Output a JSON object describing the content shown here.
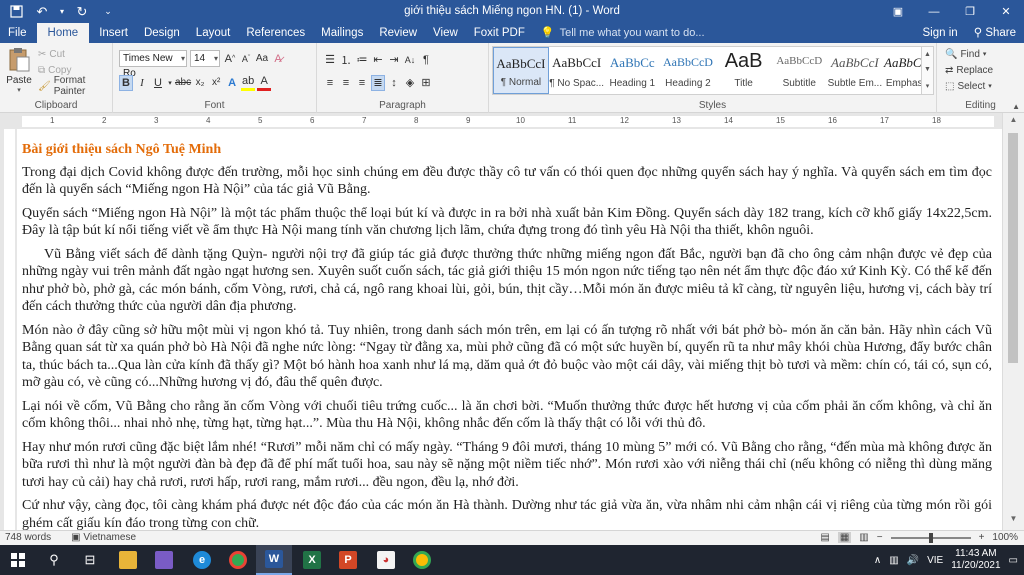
{
  "titlebar": {
    "title": "giới thiệu sách Miếng ngon HN. (1) - Word",
    "controls": [
      "ribbon-display-icon",
      "minimize-icon",
      "restore-icon",
      "close-icon"
    ]
  },
  "tabs": {
    "items": [
      "File",
      "Home",
      "Insert",
      "Design",
      "Layout",
      "References",
      "Mailings",
      "Review",
      "View",
      "Foxit PDF"
    ],
    "active": "Home",
    "tell_me": "Tell me what you want to do...",
    "sign_in": "Sign in",
    "share": "Share"
  },
  "ribbon": {
    "clipboard": {
      "label": "Clipboard",
      "paste": "Paste",
      "cut": "Cut",
      "copy": "Copy",
      "format_painter": "Format Painter"
    },
    "font": {
      "label": "Font",
      "font_name": "Times New Ro",
      "font_size": "14"
    },
    "paragraph": {
      "label": "Paragraph"
    },
    "styles": {
      "label": "Styles",
      "items": [
        {
          "preview": "AaBbCcI",
          "name": "¶ Normal"
        },
        {
          "preview": "AaBbCcI",
          "name": "¶ No Spac..."
        },
        {
          "preview": "AaBbCc",
          "name": "Heading 1"
        },
        {
          "preview": "AaBbCcD",
          "name": "Heading 2"
        },
        {
          "preview": "AaB",
          "name": "Title"
        },
        {
          "preview": "AaBbCcD",
          "name": "Subtitle"
        },
        {
          "preview": "AaBbCcI",
          "name": "Subtle Em..."
        },
        {
          "preview": "AaBbCcI",
          "name": "Emphasis"
        }
      ]
    },
    "editing": {
      "label": "Editing",
      "find": "Find",
      "replace": "Replace",
      "select": "Select"
    }
  },
  "ruler_numbers": [
    "1",
    "2",
    "3",
    "4",
    "5",
    "6",
    "7",
    "8",
    "9",
    "10",
    "11",
    "12",
    "13",
    "14",
    "15",
    "16",
    "17",
    "18"
  ],
  "document": {
    "heading": "Bài giới thiệu sách Ngô Tuệ Minh",
    "paragraphs": [
      "Trong đại dịch Covid không được đến trường, mỗi học sinh chúng em đều được thầy cô tư vấn có thói quen đọc những quyển sách hay ý nghĩa. Và quyển sách em tìm đọc đến là quyển sách “Miếng ngon Hà Nội” của tác giả Vũ Bằng.",
      "Quyển sách “Miếng ngon Hà Nội” là một tác phẩm thuộc thể loại bút kí và được in ra bởi nhà xuất bản Kim Đồng. Quyển sách dày 182 trang, kích cỡ khổ giấy 14x22,5cm. Đây là tập bút kí nổi tiếng viết về ẩm thực Hà Nội mang tính văn chương lịch lãm, chứa đựng trong đó tình yêu Hà Nội tha thiết, khôn nguôi.",
      "Vũ Bằng viết sách để dành tặng Quỳn- người nội trợ đã giúp tác giả được thưởng thức những miếng ngon đất Bắc, người bạn đã cho ông cảm nhận được vẻ đẹp của những ngày vui trên mảnh đất ngào ngạt hương sen. Xuyên suốt cuốn sách, tác giả giới thiệu 15 món ngon nức tiếng tạo nên nét ẩm thực độc đáo xứ Kinh Kỳ. Có thể kể đến như phở bò, phở gà, các món bánh, cốm Vòng, rươi, chả cá, ngô rang khoai lùi, gỏi, bún, thịt cầy…Mỗi món ăn được miêu tả kĩ càng, từ nguyên liệu, hương vị, cách bày trí đến cách thưởng thức của người dân địa phương.",
      "Món nào ở đây cũng sở hữu một mùi vị ngon khó tả. Tuy nhiên, trong danh sách món trên, em lại có ấn tượng rõ nhất với bát phở bò- món ăn căn bản. Hãy nhìn cách Vũ Bằng quan sát từ xa quán phở bò Hà Nội đã nghe nức lòng: “Ngay từ đằng xa, mùi phở cũng đã có một sức huyền bí, quyến rũ ta như mây khói chùa Hương, đẩy bước chân ta, thúc bách ta...Qua làn cửa kính đã thấy gì? Một bó hành hoa xanh như lá mạ, dăm quả ớt đỏ buộc vào một cái dây, vài miếng thịt bò tươi và mềm: chín có, tái có, sụn có, mỡ gàu có, vè cũng có...Những hương vị đó, đâu thể quên được.",
      "Lại nói về cốm, Vũ Bằng cho rằng ăn cốm Vòng với chuối tiêu trứng cuốc... là ăn chơi bời. “Muốn thưởng thức được hết hương vị của cốm phải ăn cốm không, và chỉ ăn cốm không thôi... nhai nhỏ nhẹ, từng hạt, từng hạt...”. Mùa thu Hà Nội, không nhắc đến cốm là thấy thật có lỗi với thủ đô.",
      "Hay như món rươi cũng đặc biệt lắm nhé! “Rươi” mỗi năm chỉ có mấy ngày. “Tháng 9 đôi mươi, tháng 10 mùng 5” mới có. Vũ Bằng cho rằng, “đến mùa mà không được ăn bữa rươi thì như là một người đàn bà đẹp đã để phí mất tuổi hoa, sau này sẽ nặng một niềm tiếc nhớ”. Món rươi xào với nỉễng thái chỉ (nếu không có nỉễng thì dùng măng tươi hay củ cải) hay chả rươi, rươi hấp, rươi rang, mắm rươi... đều ngon, đều lạ, nhớ đời.",
      "Cứ như vậy, càng đọc, tôi càng khám phá được nét độc đáo của các món ăn Hà thành. Dường như tác giả vừa ăn, vừa nhâm nhi cảm nhận cái vị riêng của từng món rồi gói ghém cất giấu kín đáo trong từng con chữ."
    ]
  },
  "statusbar": {
    "word_count": "748 words",
    "language": "Vietnamese",
    "zoom": "100%",
    "zoom_level_fraction": 0.5
  },
  "taskbar": {
    "apps": [
      "windows-start-icon",
      "search-icon",
      "task-view-icon",
      "file-explorer-icon",
      "edge-icon",
      "chrome-icon",
      "word-icon",
      "excel-icon",
      "powerpoint-icon",
      "chrome-icon-2"
    ],
    "tray": {
      "language": "VIE",
      "time": "11:43 AM",
      "date": "11/20/2021"
    }
  },
  "colors": {
    "word_blue": "#2b579a",
    "heading_orange": "#e36c09",
    "taskbar": "#1f2530"
  }
}
